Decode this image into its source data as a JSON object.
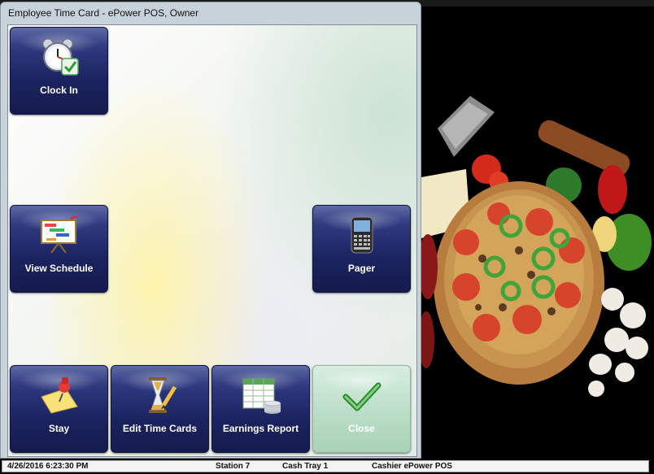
{
  "window": {
    "title": "Employee Time Card - ePower POS, Owner"
  },
  "tiles": {
    "clock_in": {
      "label": "Clock In",
      "icon": "alarm-clock-checkmark-icon"
    },
    "view_schedule": {
      "label": "View Schedule",
      "icon": "gantt-chart-icon"
    },
    "pager": {
      "label": "Pager",
      "icon": "blackberry-phone-icon"
    },
    "stay": {
      "label": "Stay",
      "icon": "pushpin-note-icon"
    },
    "edit_time_cards": {
      "label": "Edit Time Cards",
      "icon": "hourglass-pencil-icon"
    },
    "earnings_report": {
      "label": "Earnings Report",
      "icon": "spreadsheet-coins-icon"
    },
    "close": {
      "label": "Close",
      "icon": "checkmark-icon",
      "enabled": false
    }
  },
  "status_bar": {
    "datetime": "4/26/2016 6:23:30 PM",
    "station": "Station 7",
    "cash_tray": "Cash Tray 1",
    "cashier": "Cashier ePower POS"
  },
  "colors": {
    "tile": "#1c2461",
    "tile_disabled": "#b8dcc5",
    "accent_check": "#4aa84a"
  }
}
